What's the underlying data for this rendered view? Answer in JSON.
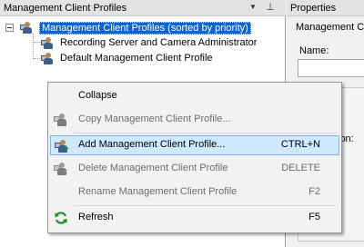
{
  "left_pane": {
    "title": "Management Client Profiles",
    "tree": {
      "root_label": "Management Client Profiles (sorted by priority)",
      "children": [
        {
          "label": "Recording Server and Camera Administrator"
        },
        {
          "label": "Default Management Client Profile"
        }
      ]
    }
  },
  "right_pane": {
    "title": "Properties",
    "subheader": "Management C",
    "name_label": "Name:",
    "name_value": "",
    "partial_label": "ion:"
  },
  "context_menu": {
    "items": [
      {
        "label": "Collapse",
        "shortcut": "",
        "enabled": true,
        "icon": "none"
      },
      {
        "label": "Copy Management Client Profile...",
        "shortcut": "",
        "enabled": false,
        "icon": "copy-profile-icon"
      },
      {
        "label": "Add Management Client Profile...",
        "shortcut": "CTRL+N",
        "enabled": true,
        "highlighted": true,
        "icon": "add-profile-icon"
      },
      {
        "label": "Delete Management Client Profile",
        "shortcut": "DELETE",
        "enabled": false,
        "icon": "delete-profile-icon"
      },
      {
        "label": "Rename Management Client Profile",
        "shortcut": "F2",
        "enabled": false,
        "icon": "none"
      },
      {
        "label": "Refresh",
        "shortcut": "F5",
        "enabled": true,
        "icon": "refresh-icon"
      }
    ]
  },
  "colors": {
    "selection": "#0a64d8",
    "menu_highlight": "#cde8ff",
    "menu_highlight_border": "#7eb4ea",
    "disabled_text": "#6d6d6d",
    "refresh_green": "#1e8f2a"
  }
}
